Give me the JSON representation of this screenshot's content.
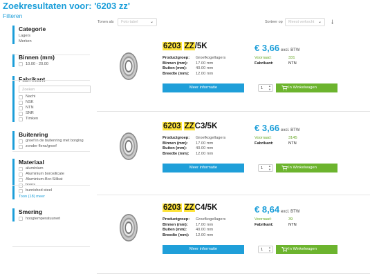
{
  "header": {
    "title": "Zoekresultaten voor: '6203 zz'",
    "filters_link": "Filteren"
  },
  "toolbar": {
    "show_as_label": "Tonen als",
    "show_as_value": "Foto tabel",
    "sort_label": "Sorteer op",
    "sort_value": "Meest verkocht"
  },
  "sidebar": {
    "categorie": {
      "title": "Categorie",
      "items": [
        "Lagers",
        "Merken"
      ]
    },
    "binnen": {
      "title": "Binnen (mm)",
      "option": "10.00 - 20.00"
    },
    "fabrikant": {
      "title": "Fabrikant",
      "search_placeholder": "Zoeken",
      "options": [
        "Nachi",
        "NSK",
        "NTN",
        "SNR",
        "Timken"
      ]
    },
    "buitenring": {
      "title": "Buitenring",
      "options": [
        "groef in de buitenring met borging",
        "zonder flens/groef"
      ]
    },
    "materiaal": {
      "title": "Materiaal",
      "options": [
        "aluminium",
        "Aluminium borosilicate",
        "Aluminium-Bor-Silikat",
        "brons",
        "burnished steel"
      ],
      "show_more": "Toon (18) meer"
    },
    "smering": {
      "title": "Smering",
      "options": [
        "hoogtemperatuurvet"
      ]
    }
  },
  "products": [
    {
      "name_hl1": "6203",
      "name_hl2": "ZZ",
      "name_rest": "/5K",
      "specs": {
        "productgroep_label": "Productgroep:",
        "productgroep": "Groefkogellagers",
        "binnen_label": "Binnen (mm):",
        "binnen": "17.00 mm",
        "buiten_label": "Buiten (mm):",
        "buiten": "40.00 mm",
        "breedte_label": "Breedte (mm):",
        "breedte": "12.00 mm"
      },
      "price": "€ 3,66",
      "excl": "excl. BTW",
      "voorraad_label": "Voorraad:",
      "voorraad": "331",
      "fabrikant_label": "Fabrikant:",
      "fabrikant": "NTN",
      "more_label": "Meer informatie",
      "qty": "1",
      "cart_label": "In Winkelwagen"
    },
    {
      "name_hl1": "6203",
      "name_hl2": "ZZ",
      "name_rest": "C3/5K",
      "specs": {
        "productgroep_label": "Productgroep:",
        "productgroep": "Groefkogellagers",
        "binnen_label": "Binnen (mm):",
        "binnen": "17.00 mm",
        "buiten_label": "Buiten (mm):",
        "buiten": "40.00 mm",
        "breedte_label": "Breedte (mm):",
        "breedte": "12.00 mm"
      },
      "price": "€ 3,66",
      "excl": "excl. BTW",
      "voorraad_label": "Voorraad:",
      "voorraad": "3145",
      "fabrikant_label": "Fabrikant:",
      "fabrikant": "NTN",
      "more_label": "Meer informatie",
      "qty": "1",
      "cart_label": "In Winkelwagen"
    },
    {
      "name_hl1": "6203",
      "name_hl2": "ZZ",
      "name_rest": "C4/5K",
      "specs": {
        "productgroep_label": "Productgroep:",
        "productgroep": "Groefkogellagers",
        "binnen_label": "Binnen (mm):",
        "binnen": "17.00 mm",
        "buiten_label": "Buiten (mm):",
        "buiten": "40.00 mm",
        "breedte_label": "Breedte (mm):",
        "breedte": "12.00 mm"
      },
      "price": "€ 8,64",
      "excl": "excl. BTW",
      "voorraad_label": "Voorraad:",
      "voorraad": "39",
      "fabrikant_label": "Fabrikant:",
      "fabrikant": "NTN",
      "more_label": "Meer informatie",
      "qty": "1",
      "cart_label": "In Winkelwagen"
    }
  ],
  "colors": {
    "accent": "#1b9ed9",
    "cart": "#6cb42e",
    "highlight": "#fde33a",
    "stock": "#64a621"
  },
  "icons": [
    "chevron-down-icon",
    "sort-arrow-icon",
    "cart-icon",
    "bearing-image"
  ]
}
